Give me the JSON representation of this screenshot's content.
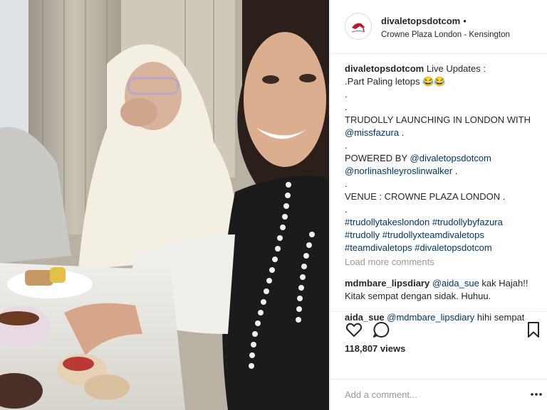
{
  "header": {
    "username": "divaletopsdotcom",
    "dot": "•",
    "location": "Crowne Plaza London - Kensington"
  },
  "caption": {
    "username": "divaletopsdotcom",
    "line1": " Live Updates :",
    "line2": ".Part Paling letops 😂😂",
    "dot1": ".",
    "dot2": ".",
    "line3": "TRUDOLLY LAUNCHING IN LONDON WITH",
    "mention1": "@missfazura",
    "line3_end": " .",
    "dot3": ".",
    "line4": "POWERED BY ",
    "mention2": "@divaletopsdotcom",
    "mention3": "@norlinashleyroslinwalker",
    "line5_end": " .",
    "dot4": ".",
    "line6": "VENUE : CROWNE PLAZA LONDON .",
    "dot5": ".",
    "hashtags1": "#trudollytakeslondon #trudollybyfazura",
    "hashtags2": "#trudolly #trudollyxteamdivaletops",
    "hashtags3": "#teamdivaletops #divaletopsdotcom"
  },
  "load_more": "Load more comments",
  "comments": [
    {
      "username": "mdmbare_lipsdiary",
      "mention": "@aida_sue",
      "text1": " kak Hajah!!",
      "text2": "Kitak sempat dengan sidak. Huhuu."
    },
    {
      "username": "aida_sue",
      "mention": "@mdmbare_lipsdiary",
      "text1": " hihi sempat"
    }
  ],
  "actions": {
    "like_icon": "heart-icon",
    "comment_icon": "comment-icon",
    "save_icon": "bookmark-icon",
    "views": "118,807 views"
  },
  "add_comment": {
    "placeholder": "Add a comment...",
    "more_icon": "more-options-icon"
  },
  "colors": {
    "link": "#003569",
    "muted": "#999999",
    "text": "#262626",
    "border": "#efefef"
  }
}
